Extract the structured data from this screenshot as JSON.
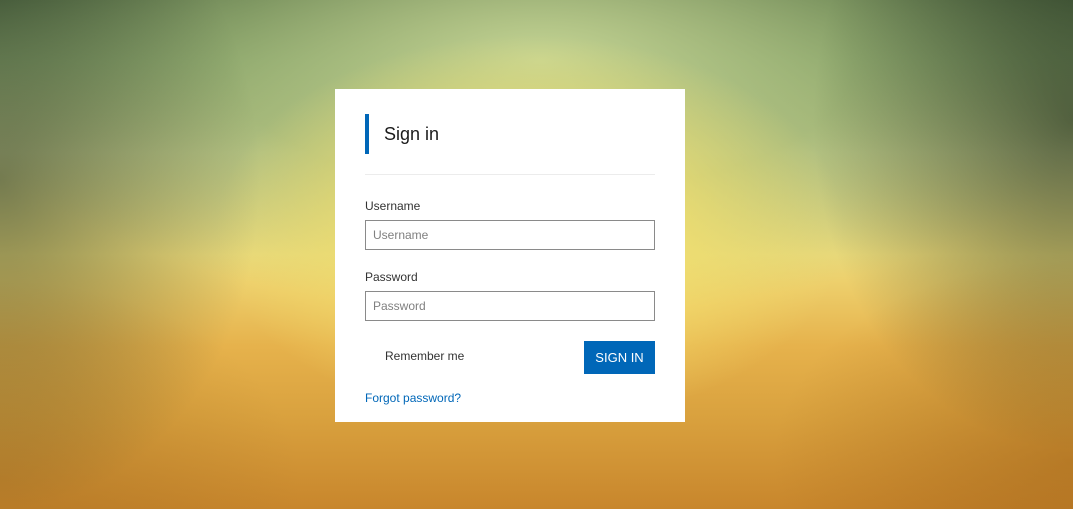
{
  "login": {
    "title": "Sign in",
    "username_label": "Username",
    "username_placeholder": "Username",
    "username_value": "",
    "password_label": "Password",
    "password_placeholder": "Password",
    "password_value": "",
    "remember_label": "Remember me",
    "signin_label": "SIGN IN",
    "forgot_label": "Forgot password?"
  },
  "colors": {
    "accent": "#0067b8",
    "card_background": "#ffffff"
  }
}
